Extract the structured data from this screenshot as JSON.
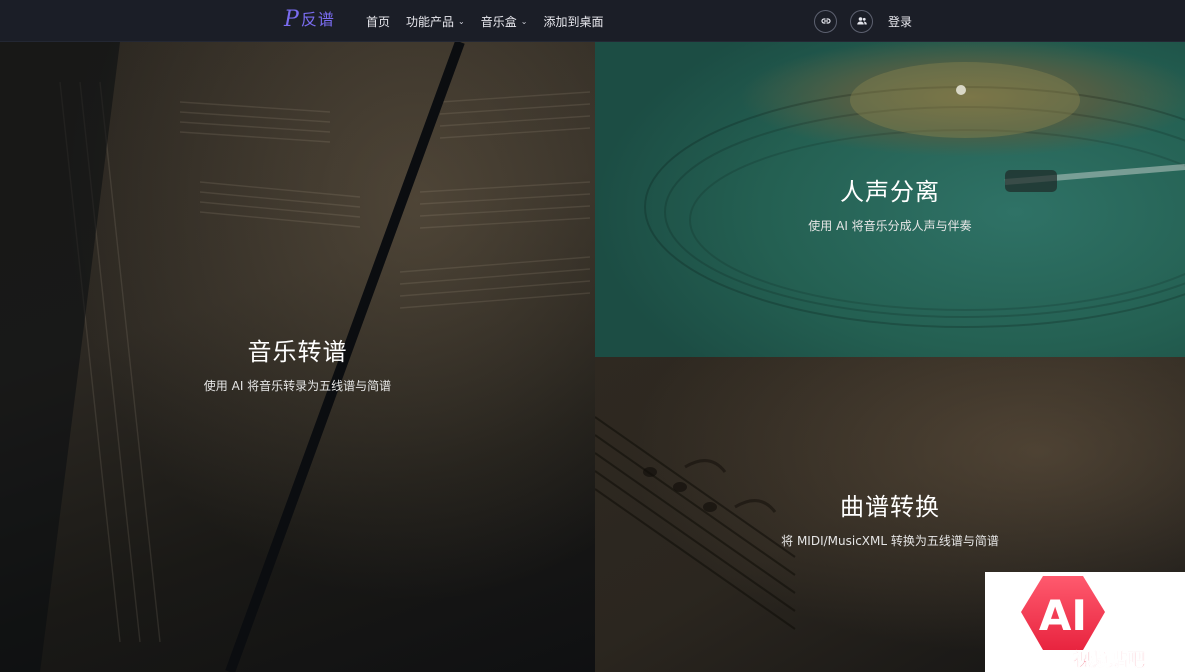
{
  "header": {
    "logo_glyph": "P",
    "brand_name": "反谱",
    "nav": [
      {
        "label": "首页",
        "has_dropdown": false
      },
      {
        "label": "功能产品",
        "has_dropdown": true
      },
      {
        "label": "音乐盒",
        "has_dropdown": true
      },
      {
        "label": "添加到桌面",
        "has_dropdown": false
      }
    ],
    "caret": "⌄",
    "icons": [
      "link-icon",
      "users-icon"
    ],
    "login_label": "登录"
  },
  "features": [
    {
      "title": "音乐转谱",
      "description": "使用 AI 将音乐转录为五线谱与简谱",
      "background": "sheet-music-photo"
    },
    {
      "title": "人声分离",
      "description": "使用 AI 将音乐分成人声与伴奏",
      "background": "turntable-photo"
    },
    {
      "title": "曲谱转换",
      "description": "将 MIDI/MusicXML 转换为五线谱与简谱",
      "background": "old-score-photo"
    }
  ],
  "watermark": {
    "logo_text": "AI",
    "label": "视频贴吧",
    "colors": {
      "gradient_top": "#ff5a6e",
      "gradient_bottom": "#e8243f",
      "text": "#ffffff"
    }
  },
  "colors": {
    "brand": "#7a6cf0",
    "navbar": "#1b1e27",
    "vocal_panel": "#246052"
  }
}
